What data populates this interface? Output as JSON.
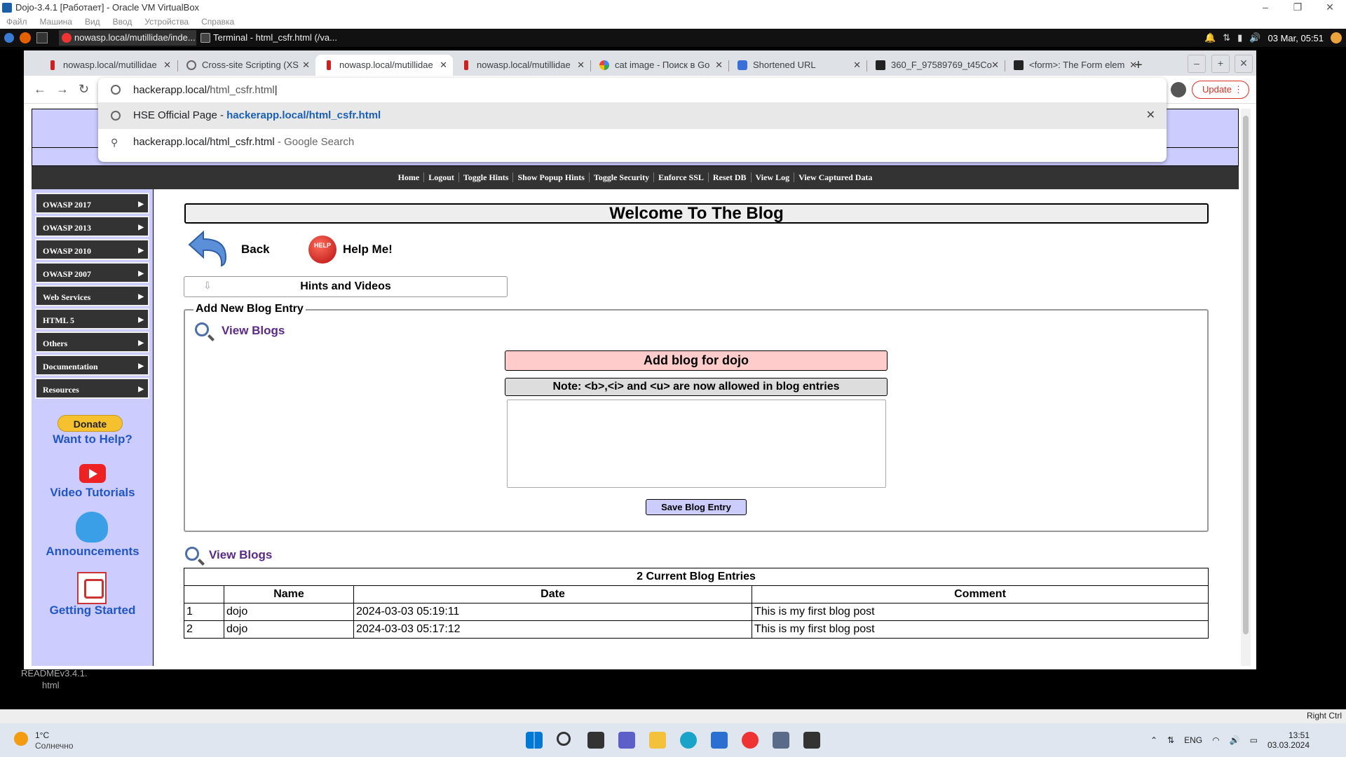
{
  "vbox": {
    "title": "Dojo-3.4.1 [Работает] - Oracle VM VirtualBox",
    "menu": [
      "Файл",
      "Машина",
      "Вид",
      "Ввод",
      "Устройства",
      "Справка"
    ]
  },
  "guest_panel": {
    "tasks": [
      "nowasp.local/mutillidae/inde...",
      "Terminal - html_csfr.html (/va..."
    ],
    "datetime": "03 Mar, 05:51"
  },
  "chrome": {
    "tabs": [
      {
        "label": "nowasp.local/mutillidae"
      },
      {
        "label": "Cross-site Scripting (XS"
      },
      {
        "label": "nowasp.local/mutillidae"
      },
      {
        "label": "nowasp.local/mutillidae"
      },
      {
        "label": "cat image - Поиск в Go"
      },
      {
        "label": "Shortened URL"
      },
      {
        "label": "360_F_97589769_t45Co"
      },
      {
        "label": "<form>: The Form elem"
      }
    ],
    "omnibox": {
      "typed": "hackerapp.local/",
      "completion": "html_csfr.html",
      "suggestion1_title": "HSE Official Page - ",
      "suggestion1_url": "hackerapp.local/html_csfr.html",
      "suggestion2_text": "hackerapp.local/html_csfr.html",
      "suggestion2_suffix": " - Google Search"
    },
    "update_label": "Update"
  },
  "nav": [
    "Home",
    "Logout",
    "Toggle Hints",
    "Show Popup Hints",
    "Toggle Security",
    "Enforce SSL",
    "Reset DB",
    "View Log",
    "View Captured Data"
  ],
  "sidebar": {
    "items": [
      "OWASP 2017",
      "OWASP 2013",
      "OWASP 2010",
      "OWASP 2007",
      "Web Services",
      "HTML 5",
      "Others",
      "Documentation",
      "Resources"
    ],
    "donate": "Donate",
    "want_help": "Want to Help?",
    "video_tutorials": "Video Tutorials",
    "announcements": "Announcements",
    "getting_started": "Getting Started"
  },
  "main": {
    "title": "Welcome To The Blog",
    "back": "Back",
    "help": "Help Me!",
    "help_badge": "HELP",
    "hints": "Hints and Videos",
    "legend": "Add New Blog Entry",
    "view_blogs": "View Blogs",
    "add_blog": "Add blog for dojo",
    "note": "Note: <b>,<i> and <u> are now allowed in blog entries",
    "save": "Save Blog Entry",
    "table": {
      "caption": "2 Current Blog Entries",
      "headers": [
        "",
        "Name",
        "Date",
        "Comment"
      ],
      "rows": [
        [
          "1",
          "dojo",
          "2024-03-03 05:19:11",
          "This is my first blog post"
        ],
        [
          "2",
          "dojo",
          "2024-03-03 05:17:12",
          "This is my first blog post"
        ]
      ]
    }
  },
  "bottom_text": [
    "READMEv3.4.1.",
    "html"
  ],
  "host": {
    "weather_temp": "1°C",
    "weather_desc": "Солнечно",
    "lang": "ENG",
    "time": "13:51",
    "date": "03.03.2024",
    "status_right": "Right Ctrl"
  }
}
